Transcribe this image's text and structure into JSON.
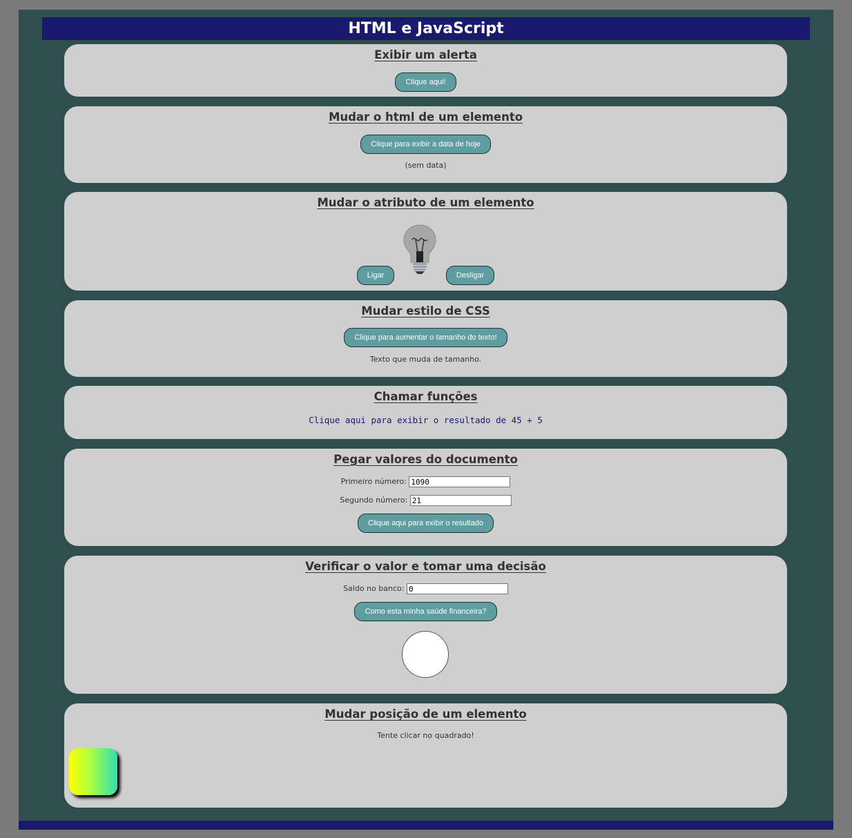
{
  "header": {
    "title": "HTML e JavaScript"
  },
  "colors": {
    "background": "#7a7a7a",
    "page": "#2f4f4f",
    "header": "#191970",
    "section": "#cfcfcf",
    "button": "#5f9ea0",
    "result_circle": "#ffffff"
  },
  "sections": {
    "alert": {
      "title": "Exibir um alerta",
      "button": "Clique aqui!"
    },
    "html_change": {
      "title": "Mudar o html de um elemento",
      "button": "Clique para exibir a data de hoje",
      "output": "(sem data)"
    },
    "attribute": {
      "title": "Mudar o atributo de um elemento",
      "on_button": "Ligar",
      "off_button": "Desligar",
      "bulb_state": "off"
    },
    "css_style": {
      "title": "Mudar estilo de CSS",
      "button": "Clique para aumentar o tamanho do texto!",
      "text": "Texto que muda de tamanho."
    },
    "functions": {
      "title": "Chamar funções",
      "link": "Clique aqui para exibir o resultado de 45 + 5"
    },
    "document_values": {
      "title": "Pegar valores do documento",
      "first_label": "Primeiro número:",
      "first_value": "1090",
      "second_label": "Segundo número:",
      "second_value": "21",
      "button": "Clique aqui para exibir o resultado"
    },
    "decision": {
      "title": "Verificar o valor e tomar uma decisão",
      "balance_label": "Saldo no banco:",
      "balance_value": "0",
      "button": "Como esta minha saúde financeira?"
    },
    "position": {
      "title": "Mudar posição de um elemento",
      "instruction": "Tente clicar no quadrado!"
    }
  }
}
